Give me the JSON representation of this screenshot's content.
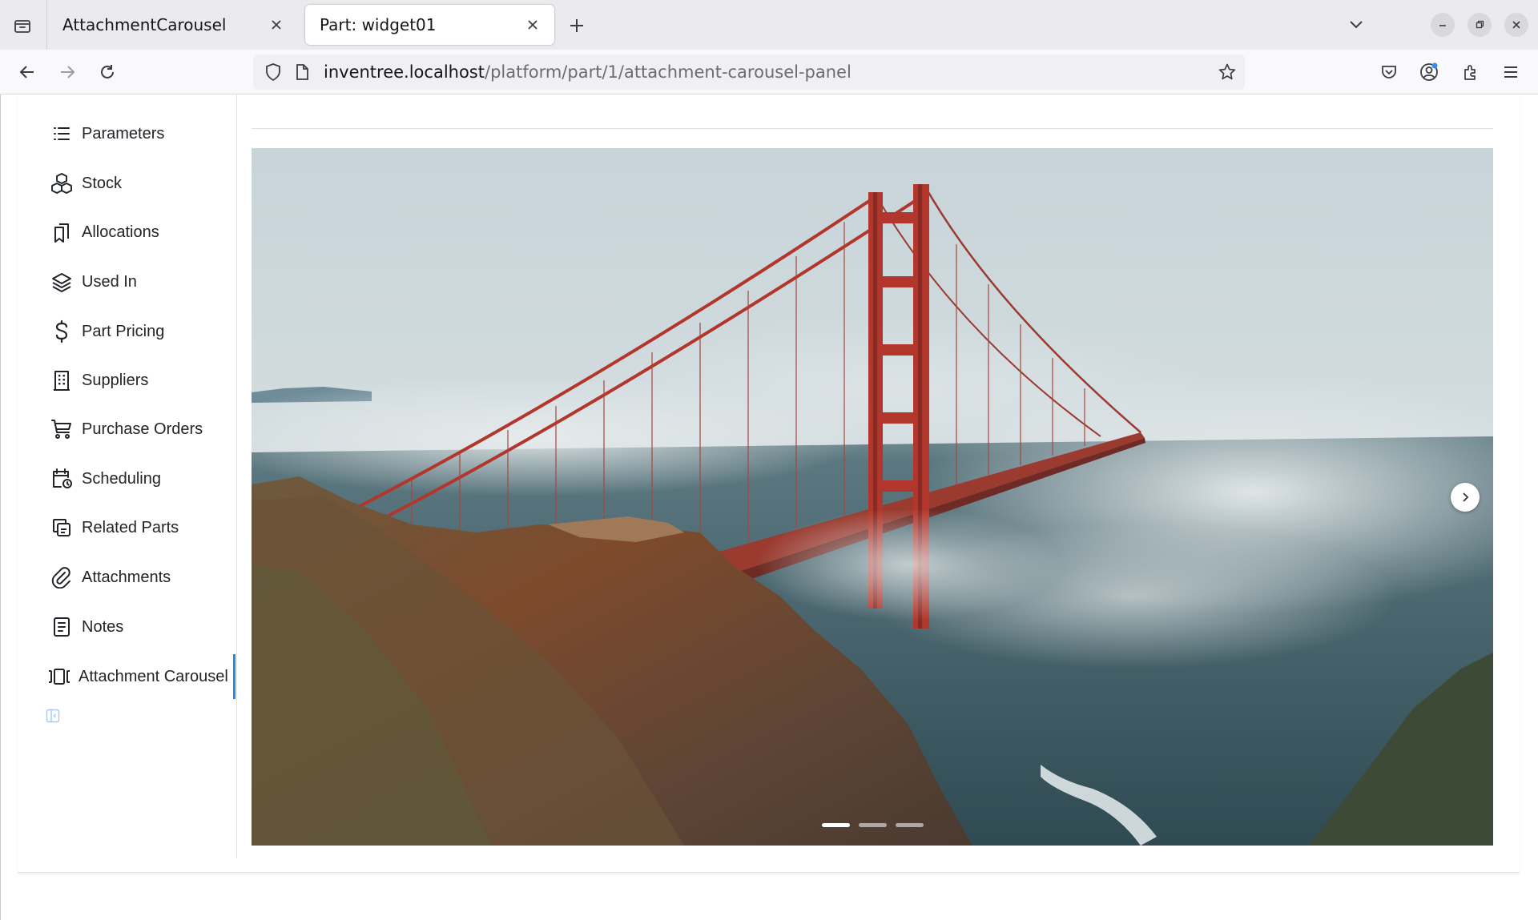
{
  "browser": {
    "tabs": [
      {
        "title": "AttachmentCarousel",
        "active": false
      },
      {
        "title": "Part: widget01",
        "active": true
      }
    ],
    "url": {
      "host": "inventree.localhost",
      "path": "/platform/part/1/attachment-carousel-panel"
    }
  },
  "sidebar": {
    "items": [
      {
        "label": "Parameters",
        "icon": "list-icon"
      },
      {
        "label": "Stock",
        "icon": "boxes-icon"
      },
      {
        "label": "Allocations",
        "icon": "bookmarks-icon"
      },
      {
        "label": "Used In",
        "icon": "stack-icon"
      },
      {
        "label": "Part Pricing",
        "icon": "dollar-icon"
      },
      {
        "label": "Suppliers",
        "icon": "building-icon"
      },
      {
        "label": "Purchase Orders",
        "icon": "cart-icon"
      },
      {
        "label": "Scheduling",
        "icon": "calendar-clock-icon"
      },
      {
        "label": "Related Parts",
        "icon": "copy-icon"
      },
      {
        "label": "Attachments",
        "icon": "paperclip-icon"
      },
      {
        "label": "Notes",
        "icon": "notes-icon"
      },
      {
        "label": "Attachment Carousel",
        "icon": "carousel-icon",
        "active": true
      }
    ]
  },
  "carousel": {
    "slide_count": 3,
    "active_slide": 1,
    "image_subject": "golden-gate-bridge-photo"
  },
  "colors": {
    "accent": "#228be6",
    "bridge": "#b3362c"
  }
}
